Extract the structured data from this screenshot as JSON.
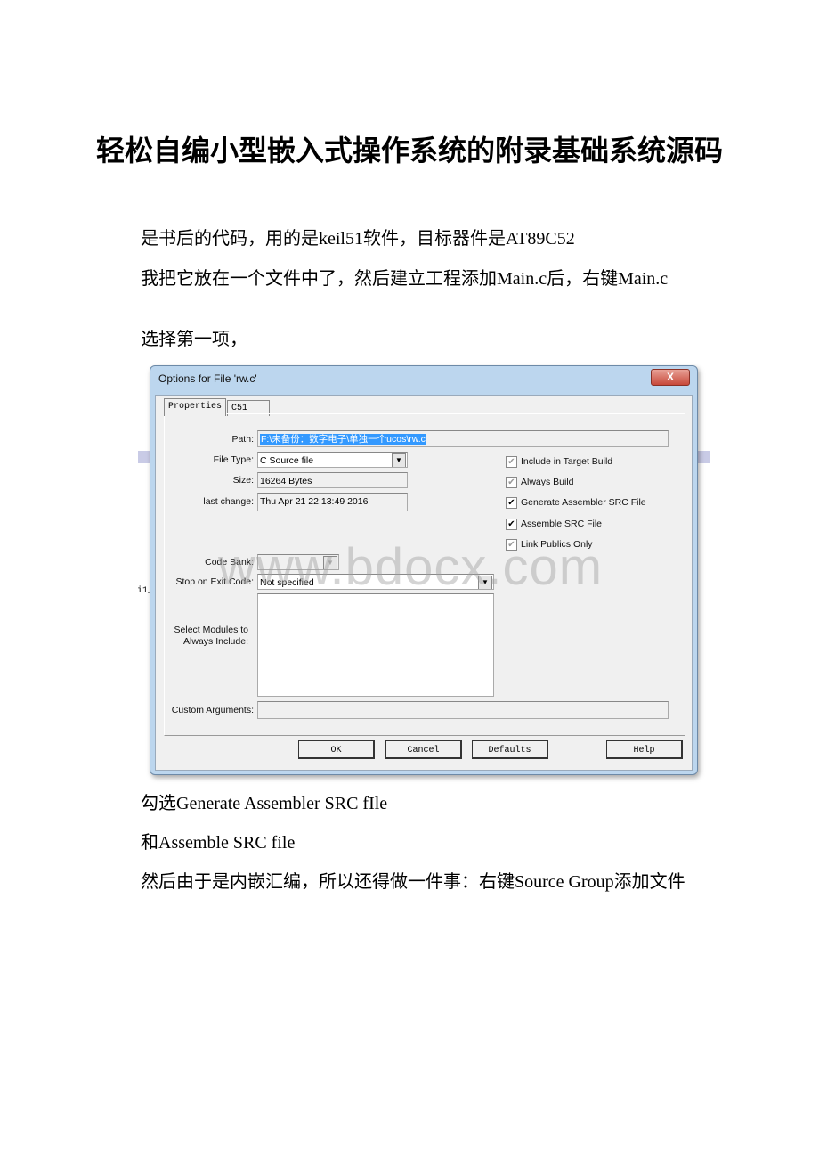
{
  "document": {
    "title": "轻松自编小型嵌入式操作系统的附录基础系统源码",
    "paragraphs_before": [
      "是书后的代码，用的是keil51软件，目标器件是AT89C52",
      "我把它放在一个文件中了，然后建立工程添加Main.c后，右键Main.c",
      "选择第一项，"
    ],
    "paragraphs_after": [
      "勾选Generate Assembler SRC fIle",
      "和Assemble SRC file",
      "然后由于是内嵌汇编，所以还得做一件事：右键Source Group添加文件"
    ],
    "margin_fragment": "i1_",
    "watermark": "www.bdocx.com"
  },
  "dialog": {
    "title": "Options for File 'rw.c'",
    "close_label": "X",
    "tabs": [
      {
        "label": "Properties",
        "active": true
      },
      {
        "label": "C51",
        "active": false
      }
    ],
    "fields": {
      "path_label": "Path:",
      "path_value": "F:\\未备份：数字电子\\单独一个ucos\\rw.c",
      "file_type_label": "File Type:",
      "file_type_value": "C Source file",
      "size_label": "Size:",
      "size_value": "16264 Bytes",
      "last_change_label": "last change:",
      "last_change_value": "Thu Apr 21 22:13:49 2016",
      "code_bank_label": "Code Bank:",
      "code_bank_value": "",
      "stop_label": "Stop on Exit Code:",
      "stop_value": "Not specified",
      "modules_label": "Select Modules to Always Include:",
      "custom_label": "Custom Arguments:",
      "custom_value": ""
    },
    "checkboxes": [
      {
        "label": "Include in Target Build",
        "checked": true,
        "disabled": true
      },
      {
        "label": "Always Build",
        "checked": true,
        "disabled": true
      },
      {
        "label": "Generate Assembler SRC File",
        "checked": true,
        "disabled": false
      },
      {
        "label": "Assemble SRC File",
        "checked": true,
        "disabled": false
      },
      {
        "label": "Link Publics Only",
        "checked": true,
        "disabled": true
      }
    ],
    "buttons": {
      "ok": "OK",
      "cancel": "Cancel",
      "defaults": "Defaults",
      "help": "Help"
    }
  }
}
